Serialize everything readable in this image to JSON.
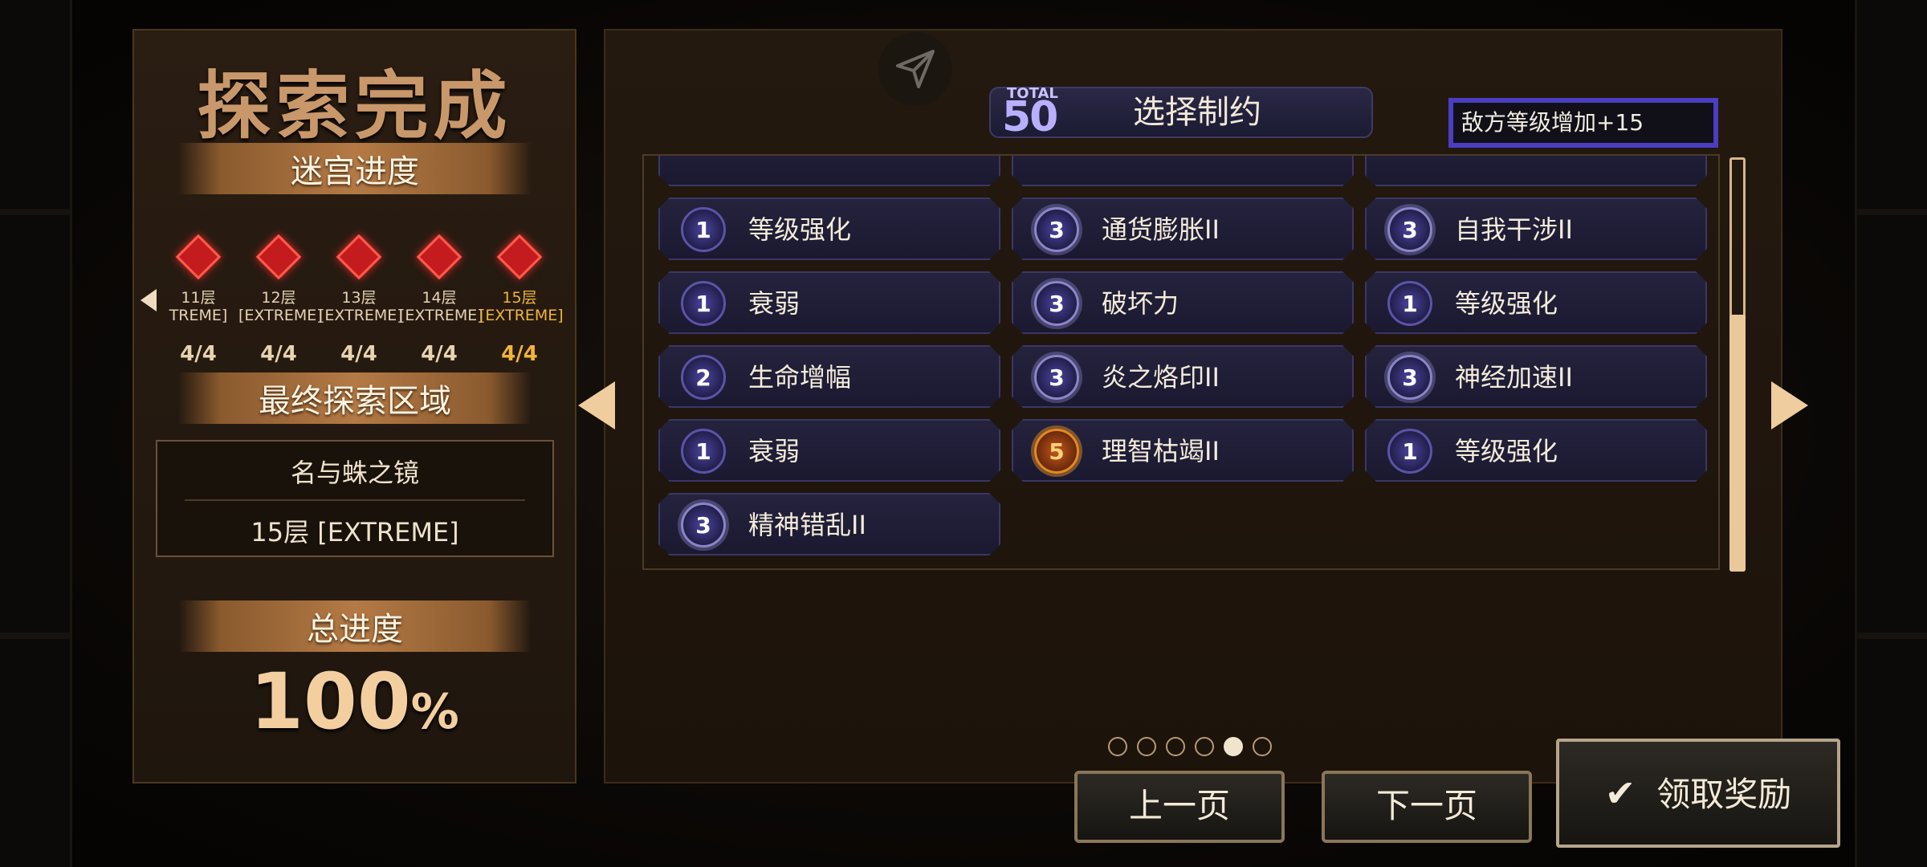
{
  "left": {
    "title": "探索完成",
    "maze_progress_label": "迷宫进度",
    "floors": [
      {
        "name": "11层",
        "difficulty": "TREME]",
        "count": "4/4",
        "current": false
      },
      {
        "name": "12层",
        "difficulty": "[EXTREME]",
        "count": "4/4",
        "current": false
      },
      {
        "name": "13层",
        "difficulty": "[EXTREME]",
        "count": "4/4",
        "current": false
      },
      {
        "name": "14层",
        "difficulty": "[EXTREME]",
        "count": "4/4",
        "current": false
      },
      {
        "name": "15层",
        "difficulty": "[EXTREME]",
        "count": "4/4",
        "current": true
      }
    ],
    "final_area_label": "最终探索区域",
    "final_area_name": "名与蛛之镜",
    "final_area_floor": "15层 [EXTREME]",
    "total_progress_label": "总进度",
    "total_progress_value": "100",
    "total_progress_unit": "%"
  },
  "right": {
    "total_label": "TOTAL",
    "total_value": "50",
    "select_title": "选择制约",
    "enemy_level_note": "敌方等级增加+15",
    "constraints": [
      [
        {
          "level": "1",
          "name": "等级强化"
        },
        {
          "level": "3",
          "name": "通货膨胀II"
        },
        {
          "level": "3",
          "name": "自我干涉II"
        }
      ],
      [
        {
          "level": "1",
          "name": "衰弱"
        },
        {
          "level": "3",
          "name": "破坏力"
        },
        {
          "level": "1",
          "name": "等级强化"
        }
      ],
      [
        {
          "level": "2",
          "name": "生命增幅"
        },
        {
          "level": "3",
          "name": "炎之烙印II"
        },
        {
          "level": "3",
          "name": "神经加速II"
        }
      ],
      [
        {
          "level": "1",
          "name": "衰弱"
        },
        {
          "level": "5",
          "name": "理智枯竭II"
        },
        {
          "level": "1",
          "name": "等级强化"
        }
      ],
      [
        {
          "level": "3",
          "name": "精神错乱II"
        }
      ]
    ],
    "page_dots": 6,
    "active_page": 5,
    "prev_label": "上一页",
    "next_label": "下一页",
    "claim_label": "领取奖励"
  },
  "colors": {
    "accent_gold": "#f0b43a",
    "card_bg": "#1e1b35",
    "selection_border": "#4a3ec2",
    "level5_orange": "#e6891d"
  },
  "icons": [
    "share-arrow-icon",
    "floor-diamond-icon",
    "scroll-left-arrow-icon",
    "scroll-right-arrow-icon",
    "check-icon"
  ]
}
